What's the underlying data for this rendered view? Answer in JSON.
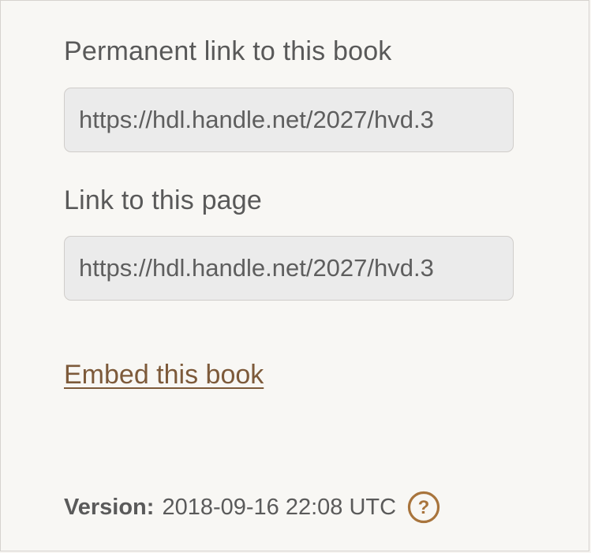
{
  "permanent_link": {
    "label": "Permanent link to this book",
    "value": "https://hdl.handle.net/2027/hvd.3"
  },
  "page_link": {
    "label": "Link to this page",
    "value": "https://hdl.handle.net/2027/hvd.3"
  },
  "embed": {
    "label": "Embed this book"
  },
  "version": {
    "label": "Version:",
    "value": "2018-09-16 22:08 UTC",
    "help_icon": "question-circle-icon"
  },
  "colors": {
    "link": "#7d5a3a",
    "icon": "#a8743c",
    "text": "#595959",
    "input_bg": "#ebebeb"
  }
}
